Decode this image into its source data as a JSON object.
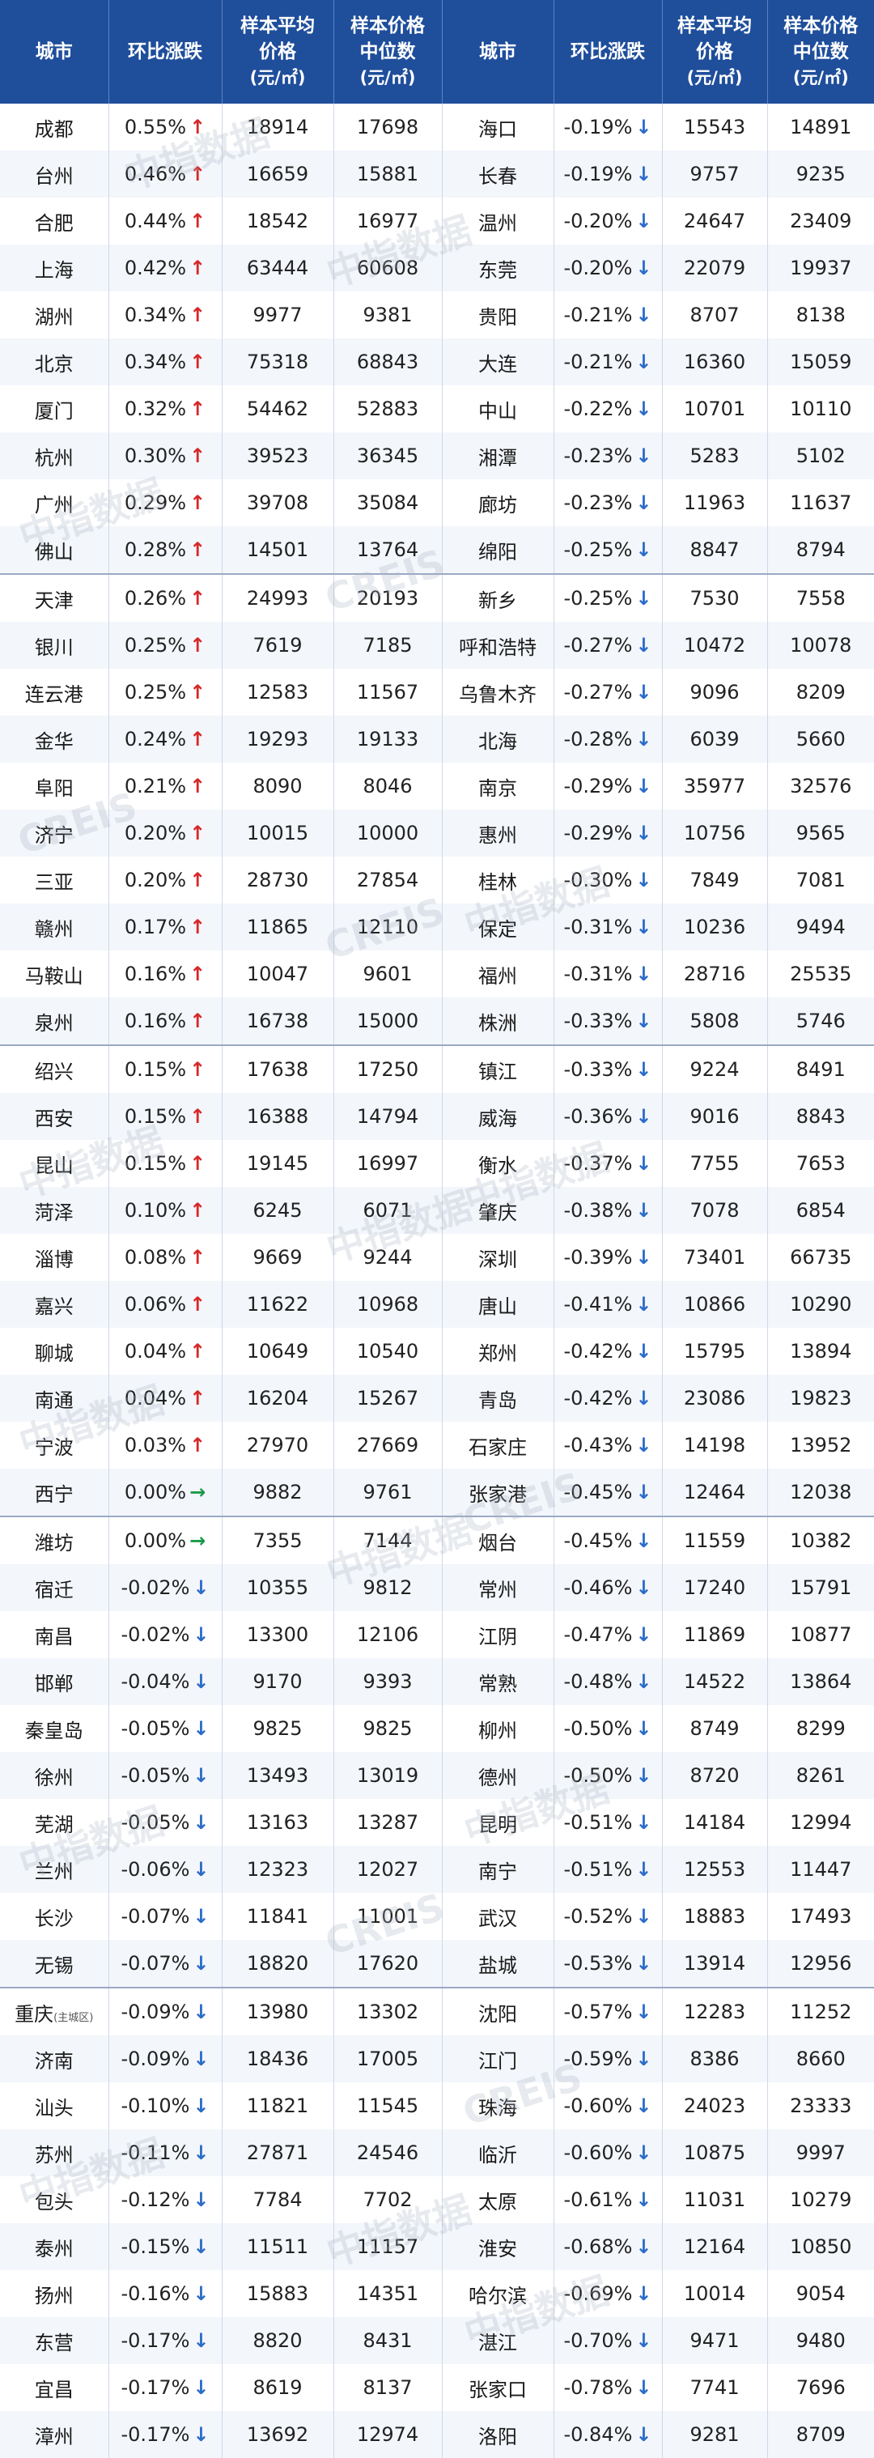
{
  "headers": {
    "city": "城市",
    "change": "环比涨跌",
    "avg_line1": "样本平均",
    "avg_line2": "价格",
    "med_line1": "样本价格",
    "med_line2": "中位数",
    "unit": "(元/㎡)"
  },
  "watermark": {
    "cn": "中指数据",
    "en": "CREIS"
  },
  "colors": {
    "header_bg": "#1f4e9b",
    "up": "#d62828",
    "down": "#2b6cc8",
    "flat": "#1a9a4a"
  },
  "rows": [
    {
      "left": {
        "city": "成都",
        "change": "0.55%",
        "dir": "up",
        "avg": "18914",
        "med": "17698"
      },
      "right": {
        "city": "海口",
        "change": "-0.19%",
        "dir": "down",
        "avg": "15543",
        "med": "14891"
      }
    },
    {
      "left": {
        "city": "台州",
        "change": "0.46%",
        "dir": "up",
        "avg": "16659",
        "med": "15881"
      },
      "right": {
        "city": "长春",
        "change": "-0.19%",
        "dir": "down",
        "avg": "9757",
        "med": "9235"
      }
    },
    {
      "left": {
        "city": "合肥",
        "change": "0.44%",
        "dir": "up",
        "avg": "18542",
        "med": "16977"
      },
      "right": {
        "city": "温州",
        "change": "-0.20%",
        "dir": "down",
        "avg": "24647",
        "med": "23409"
      }
    },
    {
      "left": {
        "city": "上海",
        "change": "0.42%",
        "dir": "up",
        "avg": "63444",
        "med": "60608"
      },
      "right": {
        "city": "东莞",
        "change": "-0.20%",
        "dir": "down",
        "avg": "22079",
        "med": "19937"
      }
    },
    {
      "left": {
        "city": "湖州",
        "change": "0.34%",
        "dir": "up",
        "avg": "9977",
        "med": "9381"
      },
      "right": {
        "city": "贵阳",
        "change": "-0.21%",
        "dir": "down",
        "avg": "8707",
        "med": "8138"
      }
    },
    {
      "left": {
        "city": "北京",
        "change": "0.34%",
        "dir": "up",
        "avg": "75318",
        "med": "68843"
      },
      "right": {
        "city": "大连",
        "change": "-0.21%",
        "dir": "down",
        "avg": "16360",
        "med": "15059"
      }
    },
    {
      "left": {
        "city": "厦门",
        "change": "0.32%",
        "dir": "up",
        "avg": "54462",
        "med": "52883"
      },
      "right": {
        "city": "中山",
        "change": "-0.22%",
        "dir": "down",
        "avg": "10701",
        "med": "10110"
      }
    },
    {
      "left": {
        "city": "杭州",
        "change": "0.30%",
        "dir": "up",
        "avg": "39523",
        "med": "36345"
      },
      "right": {
        "city": "湘潭",
        "change": "-0.23%",
        "dir": "down",
        "avg": "5283",
        "med": "5102"
      }
    },
    {
      "left": {
        "city": "广州",
        "change": "0.29%",
        "dir": "up",
        "avg": "39708",
        "med": "35084"
      },
      "right": {
        "city": "廊坊",
        "change": "-0.23%",
        "dir": "down",
        "avg": "11963",
        "med": "11637"
      }
    },
    {
      "left": {
        "city": "佛山",
        "change": "0.28%",
        "dir": "up",
        "avg": "14501",
        "med": "13764"
      },
      "right": {
        "city": "绵阳",
        "change": "-0.25%",
        "dir": "down",
        "avg": "8847",
        "med": "8794"
      }
    },
    {
      "left": {
        "city": "天津",
        "change": "0.26%",
        "dir": "up",
        "avg": "24993",
        "med": "20193"
      },
      "right": {
        "city": "新乡",
        "change": "-0.25%",
        "dir": "down",
        "avg": "7530",
        "med": "7558"
      }
    },
    {
      "left": {
        "city": "银川",
        "change": "0.25%",
        "dir": "up",
        "avg": "7619",
        "med": "7185"
      },
      "right": {
        "city": "呼和浩特",
        "change": "-0.27%",
        "dir": "down",
        "avg": "10472",
        "med": "10078"
      }
    },
    {
      "left": {
        "city": "连云港",
        "change": "0.25%",
        "dir": "up",
        "avg": "12583",
        "med": "11567"
      },
      "right": {
        "city": "乌鲁木齐",
        "change": "-0.27%",
        "dir": "down",
        "avg": "9096",
        "med": "8209"
      }
    },
    {
      "left": {
        "city": "金华",
        "change": "0.24%",
        "dir": "up",
        "avg": "19293",
        "med": "19133"
      },
      "right": {
        "city": "北海",
        "change": "-0.28%",
        "dir": "down",
        "avg": "6039",
        "med": "5660"
      }
    },
    {
      "left": {
        "city": "阜阳",
        "change": "0.21%",
        "dir": "up",
        "avg": "8090",
        "med": "8046"
      },
      "right": {
        "city": "南京",
        "change": "-0.29%",
        "dir": "down",
        "avg": "35977",
        "med": "32576"
      }
    },
    {
      "left": {
        "city": "济宁",
        "change": "0.20%",
        "dir": "up",
        "avg": "10015",
        "med": "10000"
      },
      "right": {
        "city": "惠州",
        "change": "-0.29%",
        "dir": "down",
        "avg": "10756",
        "med": "9565"
      }
    },
    {
      "left": {
        "city": "三亚",
        "change": "0.20%",
        "dir": "up",
        "avg": "28730",
        "med": "27854"
      },
      "right": {
        "city": "桂林",
        "change": "-0.30%",
        "dir": "down",
        "avg": "7849",
        "med": "7081"
      }
    },
    {
      "left": {
        "city": "赣州",
        "change": "0.17%",
        "dir": "up",
        "avg": "11865",
        "med": "12110"
      },
      "right": {
        "city": "保定",
        "change": "-0.31%",
        "dir": "down",
        "avg": "10236",
        "med": "9494"
      }
    },
    {
      "left": {
        "city": "马鞍山",
        "change": "0.16%",
        "dir": "up",
        "avg": "10047",
        "med": "9601"
      },
      "right": {
        "city": "福州",
        "change": "-0.31%",
        "dir": "down",
        "avg": "28716",
        "med": "25535"
      }
    },
    {
      "left": {
        "city": "泉州",
        "change": "0.16%",
        "dir": "up",
        "avg": "16738",
        "med": "15000"
      },
      "right": {
        "city": "株洲",
        "change": "-0.33%",
        "dir": "down",
        "avg": "5808",
        "med": "5746"
      }
    },
    {
      "left": {
        "city": "绍兴",
        "change": "0.15%",
        "dir": "up",
        "avg": "17638",
        "med": "17250"
      },
      "right": {
        "city": "镇江",
        "change": "-0.33%",
        "dir": "down",
        "avg": "9224",
        "med": "8491"
      }
    },
    {
      "left": {
        "city": "西安",
        "change": "0.15%",
        "dir": "up",
        "avg": "16388",
        "med": "14794"
      },
      "right": {
        "city": "威海",
        "change": "-0.36%",
        "dir": "down",
        "avg": "9016",
        "med": "8843"
      }
    },
    {
      "left": {
        "city": "昆山",
        "change": "0.15%",
        "dir": "up",
        "avg": "19145",
        "med": "16997"
      },
      "right": {
        "city": "衡水",
        "change": "-0.37%",
        "dir": "down",
        "avg": "7755",
        "med": "7653"
      }
    },
    {
      "left": {
        "city": "菏泽",
        "change": "0.10%",
        "dir": "up",
        "avg": "6245",
        "med": "6071"
      },
      "right": {
        "city": "肇庆",
        "change": "-0.38%",
        "dir": "down",
        "avg": "7078",
        "med": "6854"
      }
    },
    {
      "left": {
        "city": "淄博",
        "change": "0.08%",
        "dir": "up",
        "avg": "9669",
        "med": "9244"
      },
      "right": {
        "city": "深圳",
        "change": "-0.39%",
        "dir": "down",
        "avg": "73401",
        "med": "66735"
      }
    },
    {
      "left": {
        "city": "嘉兴",
        "change": "0.06%",
        "dir": "up",
        "avg": "11622",
        "med": "10968"
      },
      "right": {
        "city": "唐山",
        "change": "-0.41%",
        "dir": "down",
        "avg": "10866",
        "med": "10290"
      }
    },
    {
      "left": {
        "city": "聊城",
        "change": "0.04%",
        "dir": "up",
        "avg": "10649",
        "med": "10540"
      },
      "right": {
        "city": "郑州",
        "change": "-0.42%",
        "dir": "down",
        "avg": "15795",
        "med": "13894"
      }
    },
    {
      "left": {
        "city": "南通",
        "change": "0.04%",
        "dir": "up",
        "avg": "16204",
        "med": "15267"
      },
      "right": {
        "city": "青岛",
        "change": "-0.42%",
        "dir": "down",
        "avg": "23086",
        "med": "19823"
      }
    },
    {
      "left": {
        "city": "宁波",
        "change": "0.03%",
        "dir": "up",
        "avg": "27970",
        "med": "27669"
      },
      "right": {
        "city": "石家庄",
        "change": "-0.43%",
        "dir": "down",
        "avg": "14198",
        "med": "13952"
      }
    },
    {
      "left": {
        "city": "西宁",
        "change": "0.00%",
        "dir": "flat",
        "avg": "9882",
        "med": "9761"
      },
      "right": {
        "city": "张家港",
        "change": "-0.45%",
        "dir": "down",
        "avg": "12464",
        "med": "12038"
      }
    },
    {
      "left": {
        "city": "潍坊",
        "change": "0.00%",
        "dir": "flat",
        "avg": "7355",
        "med": "7144"
      },
      "right": {
        "city": "烟台",
        "change": "-0.45%",
        "dir": "down",
        "avg": "11559",
        "med": "10382"
      }
    },
    {
      "left": {
        "city": "宿迁",
        "change": "-0.02%",
        "dir": "down",
        "avg": "10355",
        "med": "9812"
      },
      "right": {
        "city": "常州",
        "change": "-0.46%",
        "dir": "down",
        "avg": "17240",
        "med": "15791"
      }
    },
    {
      "left": {
        "city": "南昌",
        "change": "-0.02%",
        "dir": "down",
        "avg": "13300",
        "med": "12106"
      },
      "right": {
        "city": "江阴",
        "change": "-0.47%",
        "dir": "down",
        "avg": "11869",
        "med": "10877"
      }
    },
    {
      "left": {
        "city": "邯郸",
        "change": "-0.04%",
        "dir": "down",
        "avg": "9170",
        "med": "9393"
      },
      "right": {
        "city": "常熟",
        "change": "-0.48%",
        "dir": "down",
        "avg": "14522",
        "med": "13864"
      }
    },
    {
      "left": {
        "city": "秦皇岛",
        "change": "-0.05%",
        "dir": "down",
        "avg": "9825",
        "med": "9825"
      },
      "right": {
        "city": "柳州",
        "change": "-0.50%",
        "dir": "down",
        "avg": "8749",
        "med": "8299"
      }
    },
    {
      "left": {
        "city": "徐州",
        "change": "-0.05%",
        "dir": "down",
        "avg": "13493",
        "med": "13019"
      },
      "right": {
        "city": "德州",
        "change": "-0.50%",
        "dir": "down",
        "avg": "8720",
        "med": "8261"
      }
    },
    {
      "left": {
        "city": "芜湖",
        "change": "-0.05%",
        "dir": "down",
        "avg": "13163",
        "med": "13287"
      },
      "right": {
        "city": "昆明",
        "change": "-0.51%",
        "dir": "down",
        "avg": "14184",
        "med": "12994"
      }
    },
    {
      "left": {
        "city": "兰州",
        "change": "-0.06%",
        "dir": "down",
        "avg": "12323",
        "med": "12027"
      },
      "right": {
        "city": "南宁",
        "change": "-0.51%",
        "dir": "down",
        "avg": "12553",
        "med": "11447"
      }
    },
    {
      "left": {
        "city": "长沙",
        "change": "-0.07%",
        "dir": "down",
        "avg": "11841",
        "med": "11001"
      },
      "right": {
        "city": "武汉",
        "change": "-0.52%",
        "dir": "down",
        "avg": "18883",
        "med": "17493"
      }
    },
    {
      "left": {
        "city": "无锡",
        "change": "-0.07%",
        "dir": "down",
        "avg": "18820",
        "med": "17620"
      },
      "right": {
        "city": "盐城",
        "change": "-0.53%",
        "dir": "down",
        "avg": "13914",
        "med": "12956"
      }
    },
    {
      "left": {
        "city": "重庆",
        "city_sub": "(主城区)",
        "change": "-0.09%",
        "dir": "down",
        "avg": "13980",
        "med": "13302"
      },
      "right": {
        "city": "沈阳",
        "change": "-0.57%",
        "dir": "down",
        "avg": "12283",
        "med": "11252"
      }
    },
    {
      "left": {
        "city": "济南",
        "change": "-0.09%",
        "dir": "down",
        "avg": "18436",
        "med": "17005"
      },
      "right": {
        "city": "江门",
        "change": "-0.59%",
        "dir": "down",
        "avg": "8386",
        "med": "8660"
      }
    },
    {
      "left": {
        "city": "汕头",
        "change": "-0.10%",
        "dir": "down",
        "avg": "11821",
        "med": "11545"
      },
      "right": {
        "city": "珠海",
        "change": "-0.60%",
        "dir": "down",
        "avg": "24023",
        "med": "23333"
      }
    },
    {
      "left": {
        "city": "苏州",
        "change": "-0.11%",
        "dir": "down",
        "avg": "27871",
        "med": "24546"
      },
      "right": {
        "city": "临沂",
        "change": "-0.60%",
        "dir": "down",
        "avg": "10875",
        "med": "9997"
      }
    },
    {
      "left": {
        "city": "包头",
        "change": "-0.12%",
        "dir": "down",
        "avg": "7784",
        "med": "7702"
      },
      "right": {
        "city": "太原",
        "change": "-0.61%",
        "dir": "down",
        "avg": "11031",
        "med": "10279"
      }
    },
    {
      "left": {
        "city": "泰州",
        "change": "-0.15%",
        "dir": "down",
        "avg": "11511",
        "med": "11157"
      },
      "right": {
        "city": "淮安",
        "change": "-0.68%",
        "dir": "down",
        "avg": "12164",
        "med": "10850"
      }
    },
    {
      "left": {
        "city": "扬州",
        "change": "-0.16%",
        "dir": "down",
        "avg": "15883",
        "med": "14351"
      },
      "right": {
        "city": "哈尔滨",
        "change": "-0.69%",
        "dir": "down",
        "avg": "10014",
        "med": "9054"
      }
    },
    {
      "left": {
        "city": "东营",
        "change": "-0.17%",
        "dir": "down",
        "avg": "8820",
        "med": "8431"
      },
      "right": {
        "city": "湛江",
        "change": "-0.70%",
        "dir": "down",
        "avg": "9471",
        "med": "9480"
      }
    },
    {
      "left": {
        "city": "宜昌",
        "change": "-0.17%",
        "dir": "down",
        "avg": "8619",
        "med": "8137"
      },
      "right": {
        "city": "张家口",
        "change": "-0.78%",
        "dir": "down",
        "avg": "7741",
        "med": "7696"
      }
    },
    {
      "left": {
        "city": "漳州",
        "change": "-0.17%",
        "dir": "down",
        "avg": "13692",
        "med": "12974"
      },
      "right": {
        "city": "洛阳",
        "change": "-0.84%",
        "dir": "down",
        "avg": "9281",
        "med": "8709"
      }
    }
  ]
}
